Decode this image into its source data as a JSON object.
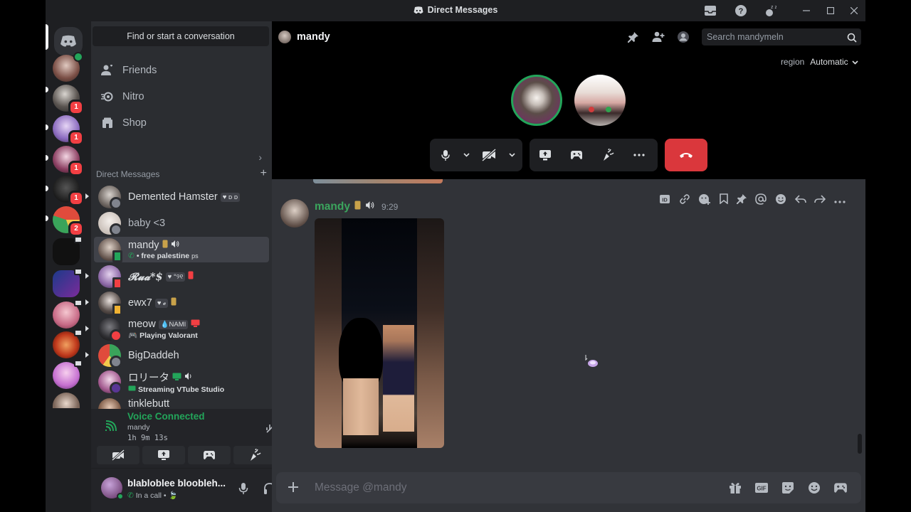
{
  "window": {
    "title": "Direct Messages"
  },
  "sidebar": {
    "search_placeholder": "Find or start a conversation",
    "nav": [
      {
        "label": "Friends",
        "icon": "friends-icon"
      },
      {
        "label": "Nitro",
        "icon": "nitro-icon"
      },
      {
        "label": "Shop",
        "icon": "shop-icon"
      }
    ],
    "direct_messages_label": "Direct Messages",
    "dms": [
      {
        "name": "Demented Hamster",
        "tag": "♥ ᴅ ᴅ",
        "status": "idle",
        "sub": ""
      },
      {
        "name": "baby <3",
        "tag": "",
        "status": "offline",
        "sub": ""
      },
      {
        "name": "mandy",
        "tag": "",
        "status": "mobile",
        "sub": "• free palestine",
        "sub_tag": "ps",
        "active": true
      },
      {
        "name": "𝓡𝓾𝓪*$",
        "tag": "♥ °୨୧",
        "status": "dnd",
        "sub": ""
      },
      {
        "name": "ewx7",
        "tag": "♥ 𝓮",
        "status": "mobile",
        "sub": ""
      },
      {
        "name": "meow",
        "tag": "NAMI",
        "status": "dnd",
        "sub": "Playing Valorant"
      },
      {
        "name": "BigDaddeh",
        "tag": "",
        "status": "offline",
        "sub": ""
      },
      {
        "name": "ロリータ",
        "tag": "",
        "status": "online",
        "sub": "Streaming VTube Studio"
      },
      {
        "name": "tinklebutt",
        "tag": "",
        "status": "dnd",
        "sub": ""
      }
    ]
  },
  "servers": [
    {
      "badge": ""
    },
    {
      "badge": "1"
    },
    {
      "badge": "1"
    },
    {
      "badge": "1"
    },
    {
      "badge": "1"
    },
    {
      "badge": "2"
    },
    {
      "badge": ""
    },
    {
      "badge": ""
    },
    {
      "badge": ""
    },
    {
      "badge": ""
    },
    {
      "badge": ""
    },
    {
      "badge": ""
    }
  ],
  "voice": {
    "title": "Voice Connected",
    "channel": "mandy",
    "elapsed": "1h 9m 13s"
  },
  "user": {
    "name": "blabloblee bloobleh...",
    "status": "In a call •"
  },
  "header": {
    "name": "mandy",
    "search_placeholder": "Search mandymeln"
  },
  "call": {
    "region_label": "region",
    "region_value": "Automatic"
  },
  "message": {
    "author": "mandy",
    "time": "9:29"
  },
  "composer": {
    "placeholder": "Message @mandy"
  },
  "colors": {
    "accent_green": "#23a55a",
    "danger_red": "#da373c",
    "author_green": "#3ba55d"
  }
}
